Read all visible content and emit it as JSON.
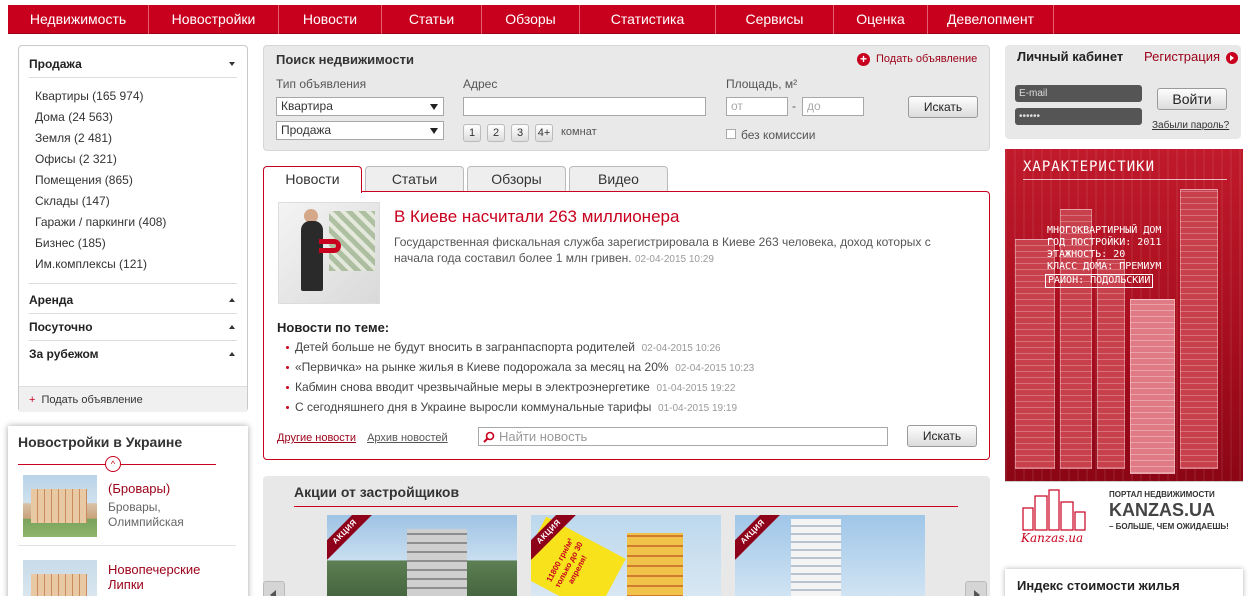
{
  "nav": [
    "Недвижимость",
    "Новостройки",
    "Новости",
    "Статьи",
    "Обзоры",
    "Статистика",
    "Сервисы",
    "Оценка",
    "Девелопмент"
  ],
  "sidebar": {
    "sale_title": "Продажа",
    "sale_items": [
      "Квартиры (165 974)",
      "Дома (24 563)",
      "Земля (2 481)",
      "Офисы (2 321)",
      "Помещения (865)",
      "Склады (147)",
      "Гаражи / паркинги (408)",
      "Бизнес (185)",
      "Им.комплексы (121)"
    ],
    "rent_title": "Аренда",
    "daily_title": "Посуточно",
    "abroad_title": "За рубежом",
    "post_ad": "Подать объявление",
    "post_ad_plus": "+"
  },
  "novostroyki": {
    "title": "Новостройки в Украине",
    "toggle_glyph": "^",
    "items": [
      {
        "title_cut": "(Бровары)",
        "subtitle": "Бровары, Олимпийская"
      },
      {
        "title": "Новопечерские Липки",
        "subtitle": ""
      }
    ]
  },
  "search": {
    "title": "Поиск недвижимости",
    "post_ad": "Подать объявление",
    "post_ad_plus": "+",
    "type_label": "Тип объявления",
    "type_value": "Квартира",
    "deal_value": "Продажа",
    "address_label": "Адрес",
    "address_value": "",
    "area_label": "Площадь, м²",
    "from_placeholder": "от",
    "to_placeholder": "до",
    "range_dash": "-",
    "rooms": [
      "1",
      "2",
      "3",
      "4+"
    ],
    "rooms_label": "комнат",
    "no_commission": "без комиссии",
    "search_button": "Искать"
  },
  "tabs": [
    "Новости",
    "Статьи",
    "Обзоры",
    "Видео"
  ],
  "news": {
    "headline": "В Киеве насчитали 263 миллионера",
    "text": "Государственная фискальная служба зарегистрировала в Киеве 263 человека, доход которых с начала года составил более 1 млн гривен.",
    "date": "02-04-2015 10:29",
    "related_title": "Новости по теме:",
    "related": [
      {
        "text": "Детей больше не будут вносить в загранпаспорта родителей",
        "date": "02-04-2015 10:26"
      },
      {
        "text": "«Первичка» на рынке жилья в Киеве подорожала за месяц на 20%",
        "date": "02-04-2015 10:23"
      },
      {
        "text": "Кабмин снова вводит чрезвычайные меры в электроэнергетике",
        "date": "01-04-2015 19:22"
      },
      {
        "text": "С сегодняшнего дня в Украине выросли коммунальные тарифы",
        "date": "01-04-2015 19:19"
      }
    ],
    "other_news": "Другие новости",
    "archive": "Архив новостей",
    "search_placeholder": "Найти новость",
    "search_button": "Искать"
  },
  "promo": {
    "title": "Акции от застройщиков",
    "ribbon": "АКЦИЯ",
    "sticker": "11800 грн/м² только до 30 апреля!"
  },
  "login": {
    "title": "Личный кабинет",
    "register": "Регистрация",
    "email_placeholder": "E-mail",
    "password_value": "••••••",
    "login_button": "Войти",
    "forgot": "Забыли пароль?"
  },
  "banner": {
    "heading": "ХАРАКТЕРИСТИКИ",
    "specs": [
      "МНОГОКВАРТИРНЫЙ ДОМ",
      "ГОД ПОСТРОЙКИ: 2011",
      "ЭТАЖНОСТЬ: 20",
      "КЛАСС ДОМА: ПРЕМИУМ",
      "РАЙОН: ПОДОЛЬСКИЙ"
    ],
    "portal": "ПОРТАЛ НЕДВИЖИМОСТИ",
    "brand": "KANZAS.UA",
    "slogan": "– БОЛЬШЕ, ЧЕМ ОЖИДАЕШЬ!",
    "logo_text": "Kanzas.ua"
  },
  "index": {
    "title": "Индекс стоимости жилья"
  }
}
